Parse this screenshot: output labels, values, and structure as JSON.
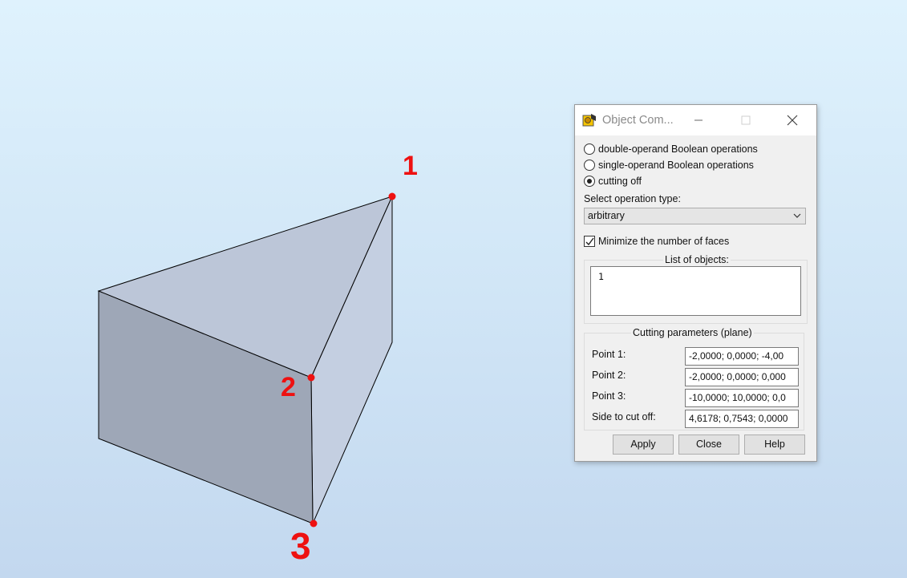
{
  "annotations": {
    "mark1": "1",
    "mark2": "2",
    "mark3": "3"
  },
  "dialog": {
    "title": "Object Com...",
    "radios": [
      {
        "label": "double-operand Boolean operations",
        "checked": false
      },
      {
        "label": "single-operand Boolean operations",
        "checked": false
      },
      {
        "label": "cutting off",
        "checked": true
      }
    ],
    "operation_type_label": "Select operation type:",
    "operation_type_value": "arbitrary",
    "minimize_faces_label": "Minimize the number of faces",
    "minimize_faces_checked": true,
    "objects_label": "List of objects:",
    "objects": [
      "1"
    ],
    "cutting_group_label": "Cutting parameters (plane)",
    "params": [
      {
        "label": "Point 1:",
        "value": "-2,0000; 0,0000; -4,00"
      },
      {
        "label": "Point 2:",
        "value": "-2,0000; 0,0000; 0,000"
      },
      {
        "label": "Point 3:",
        "value": "-10,0000; 10,0000; 0,0"
      },
      {
        "label": "Side to cut off:",
        "value": "4,6178; 0,7543; 0,0000"
      }
    ],
    "buttons": {
      "apply": "Apply",
      "close": "Close",
      "help": "Help"
    }
  },
  "colors": {
    "annotation_red": "#ee1111",
    "face_top": "#bcc6d8",
    "face_front": "#9ea7b7",
    "face_right": "#c4cfe1"
  }
}
